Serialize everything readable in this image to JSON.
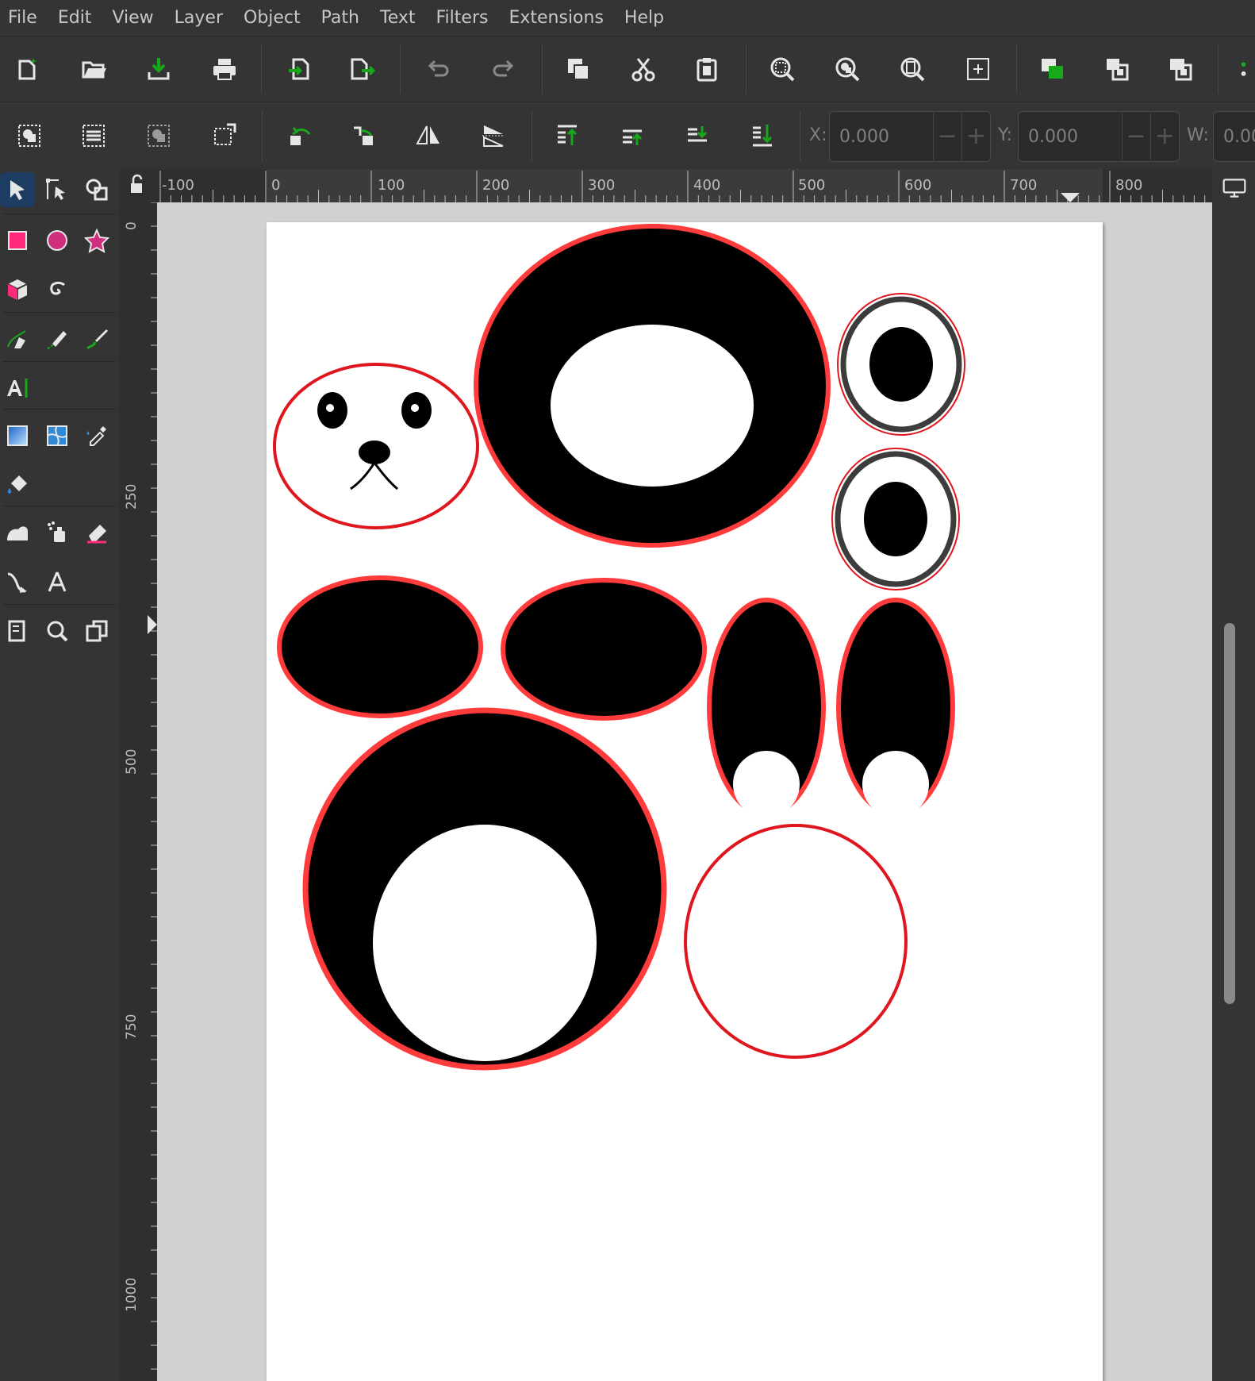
{
  "menu": [
    "File",
    "Edit",
    "View",
    "Layer",
    "Object",
    "Path",
    "Text",
    "Filters",
    "Extensions",
    "Help"
  ],
  "commands": [
    "new-document-icon",
    "open-icon",
    "save-icon",
    "print-icon",
    "import-icon",
    "export-icon",
    "undo-icon",
    "redo-icon",
    "duplicate-icon",
    "cut-icon",
    "paste-icon",
    "zoom-selection-icon",
    "zoom-drawing-icon",
    "zoom-page-icon",
    "zoom-fit-icon",
    "group-icon",
    "ungroup-icon",
    "clone-icon"
  ],
  "select_controls": [
    "select-all-icon",
    "select-all-layers-icon",
    "deselect-icon",
    "touch-select-icon",
    "rotate-ccw-icon",
    "rotate-cw-icon",
    "flip-horizontal-icon",
    "flip-vertical-icon",
    "raise-to-top-icon",
    "raise-icon",
    "lower-icon",
    "lower-to-bottom-icon"
  ],
  "coords": {
    "x_label": "X:",
    "x_value": "0.000",
    "y_label": "Y:",
    "y_value": "0.000",
    "w_label": "W:",
    "w_value": "0.00",
    "minus": "−",
    "plus": "+"
  },
  "tools": [
    "selector-tool",
    "node-tool",
    "tweak-tool",
    "rectangle-tool",
    "ellipse-tool",
    "star-tool",
    "3d-box-tool",
    "spiral-tool",
    "pen-tool",
    "pencil-tool",
    "calligraphy-tool",
    "text-tool",
    "gradient-tool",
    "mesh-tool",
    "dropper-tool",
    "paint-bucket-tool",
    "spray-tool",
    "eraser-tool",
    "pages-icon-a",
    "connector-tool",
    "measure-tool",
    "pages-tool",
    "zoom-tool",
    "lpe-tool"
  ],
  "hruler_labels": [
    "-100",
    "0",
    "100",
    "200",
    "300",
    "400",
    "500",
    "600",
    "700",
    "800"
  ],
  "vruler_labels": [
    "0",
    "250",
    "500",
    "750",
    "1000"
  ],
  "colors": {
    "accent_red": "#ff3b3b",
    "thin_red": "#e0161e",
    "fill_black": "#000000",
    "ring_gray": "#3c3c3c",
    "green_icon": "#18a81c",
    "pink_rect": "#ff2a7a",
    "magenta_circle": "#d02f7f"
  }
}
